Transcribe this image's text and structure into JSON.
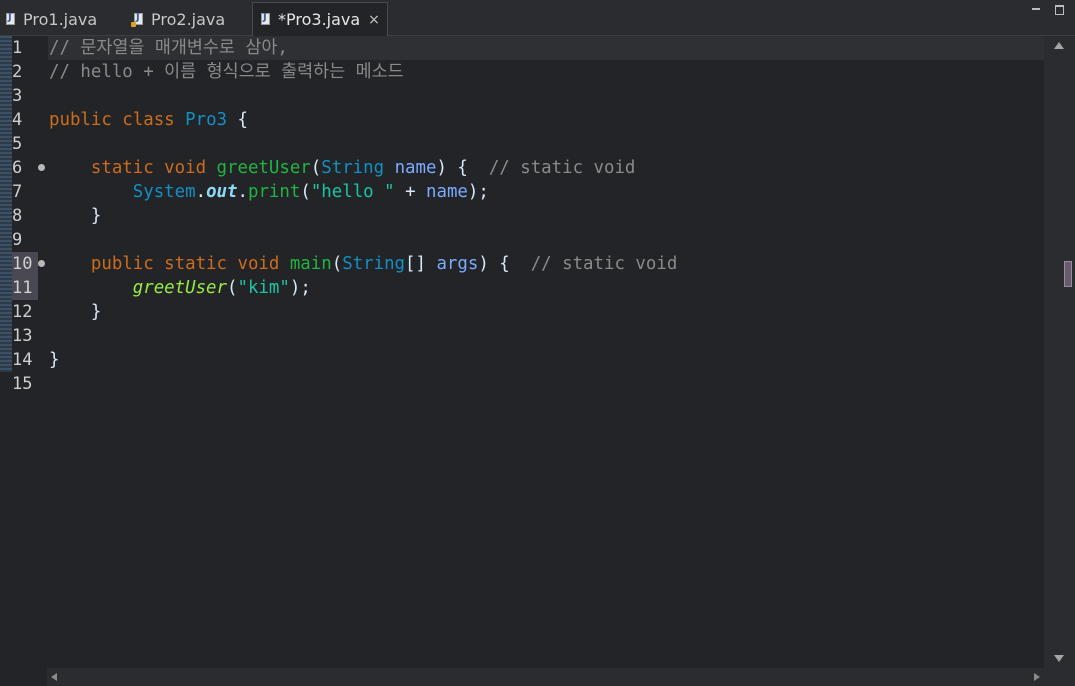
{
  "tabs": [
    {
      "label": "Pro1.java",
      "active": false,
      "icon": "java-file-icon"
    },
    {
      "label": "Pro2.java",
      "active": false,
      "icon": "java-file-warning-icon"
    },
    {
      "label": "*Pro3.java",
      "active": true,
      "icon": "java-file-icon"
    }
  ],
  "tab_close_glyph": "×",
  "colors": {
    "keyword": "#cc6c1d",
    "comment": "#8a8a8a",
    "class": "#1290c3",
    "method": "#1eb540",
    "variable": "#79abff",
    "string": "#17c6a3",
    "background": "#232427"
  },
  "editor": {
    "current_line": 1,
    "lines": [
      {
        "num": "1",
        "tokens": [
          {
            "t": "// 문자열을 매개변수로 삼아,",
            "c": "cm"
          }
        ]
      },
      {
        "num": "2",
        "tokens": [
          {
            "t": "// hello + 이름 형식으로 출력하는 메소드",
            "c": "cm"
          }
        ]
      },
      {
        "num": "3",
        "tokens": []
      },
      {
        "num": "4",
        "tokens": [
          {
            "t": "public class ",
            "c": "kw"
          },
          {
            "t": "Pro3",
            "c": "cls"
          },
          {
            "t": " {",
            "c": "plain"
          }
        ]
      },
      {
        "num": "5",
        "tokens": []
      },
      {
        "num": "6",
        "fold": true,
        "tokens": [
          {
            "t": "    ",
            "c": "plain"
          },
          {
            "t": "static void ",
            "c": "kw"
          },
          {
            "t": "greetUser",
            "c": "fn"
          },
          {
            "t": "(",
            "c": "plain"
          },
          {
            "t": "String",
            "c": "cls"
          },
          {
            "t": " ",
            "c": "plain"
          },
          {
            "t": "name",
            "c": "var"
          },
          {
            "t": ") {  ",
            "c": "plain"
          },
          {
            "t": "// static void",
            "c": "cm"
          }
        ]
      },
      {
        "num": "7",
        "tokens": [
          {
            "t": "        ",
            "c": "plain"
          },
          {
            "t": "System",
            "c": "cls"
          },
          {
            "t": ".",
            "c": "plain"
          },
          {
            "t": "out",
            "c": "fld"
          },
          {
            "t": ".",
            "c": "plain"
          },
          {
            "t": "print",
            "c": "fn"
          },
          {
            "t": "(",
            "c": "plain"
          },
          {
            "t": "\"hello \"",
            "c": "str"
          },
          {
            "t": " + ",
            "c": "plain"
          },
          {
            "t": "name",
            "c": "var"
          },
          {
            "t": ");",
            "c": "plain"
          }
        ]
      },
      {
        "num": "8",
        "tokens": [
          {
            "t": "    }",
            "c": "plain"
          }
        ]
      },
      {
        "num": "9",
        "tokens": []
      },
      {
        "num": "10",
        "fold": true,
        "highlight": true,
        "tokens": [
          {
            "t": "    ",
            "c": "plain"
          },
          {
            "t": "public static void ",
            "c": "kw"
          },
          {
            "t": "main",
            "c": "fn"
          },
          {
            "t": "(",
            "c": "plain"
          },
          {
            "t": "String",
            "c": "cls"
          },
          {
            "t": "[] ",
            "c": "plain"
          },
          {
            "t": "args",
            "c": "var"
          },
          {
            "t": ") {  ",
            "c": "plain"
          },
          {
            "t": "// static void",
            "c": "cm"
          }
        ]
      },
      {
        "num": "11",
        "highlight": true,
        "tokens": [
          {
            "t": "        ",
            "c": "plain"
          },
          {
            "t": "greetUser",
            "c": "sfn"
          },
          {
            "t": "(",
            "c": "plain"
          },
          {
            "t": "\"kim\"",
            "c": "str"
          },
          {
            "t": ");",
            "c": "plain"
          }
        ]
      },
      {
        "num": "12",
        "tokens": [
          {
            "t": "    }",
            "c": "plain"
          }
        ]
      },
      {
        "num": "13",
        "tokens": []
      },
      {
        "num": "14",
        "tokens": [
          {
            "t": "}",
            "c": "plain"
          }
        ]
      },
      {
        "num": "15",
        "tokens": []
      }
    ]
  }
}
